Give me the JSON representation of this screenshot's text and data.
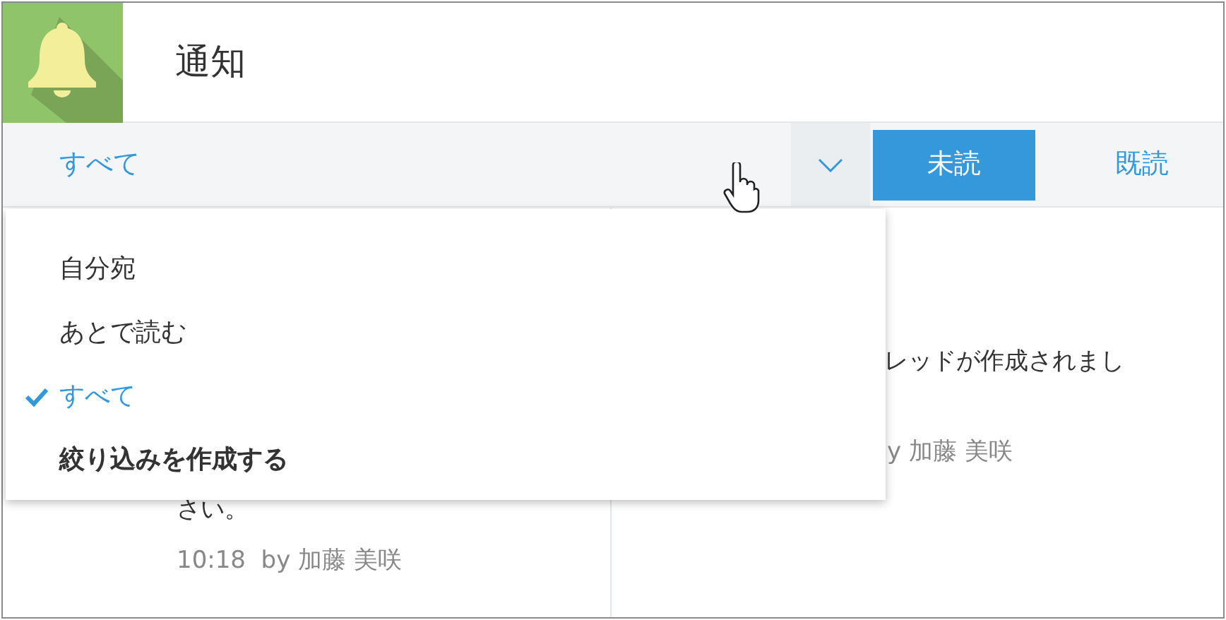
{
  "header": {
    "title": "通知"
  },
  "toolbar": {
    "filter": {
      "value": "すべて",
      "expanded": true
    },
    "buttons": [
      {
        "label": "未読",
        "selected": true
      },
      {
        "label": "既読",
        "selected": false
      }
    ]
  },
  "dropdown": {
    "items": [
      {
        "label": "自分宛",
        "selected": false,
        "kind": "filter"
      },
      {
        "label": "あとで読む",
        "selected": false,
        "kind": "filter"
      },
      {
        "label": "すべて",
        "selected": true,
        "kind": "filter"
      },
      {
        "label": "絞り込みを作成する",
        "selected": false,
        "kind": "action"
      }
    ]
  },
  "left_pane": {
    "message": "さい。",
    "meta": "10:18  by 加藤 美咲"
  },
  "right_pane": {
    "message": "レッドが作成されまし",
    "meta": "y 加藤 美咲"
  }
}
